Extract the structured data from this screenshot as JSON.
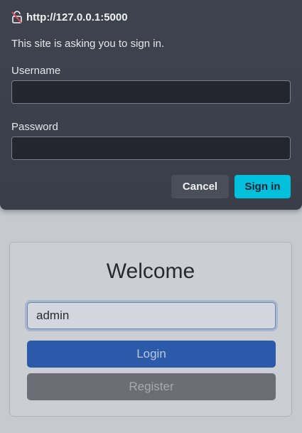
{
  "auth_dialog": {
    "site": "http://127.0.0.1:5000",
    "message": "This site is asking you to sign in.",
    "username_label": "Username",
    "username_value": "",
    "password_label": "Password",
    "password_value": "",
    "cancel_label": "Cancel",
    "signin_label": "Sign in",
    "lock_icon": "lock-warning-icon",
    "accent_color": "#00c0dc"
  },
  "page": {
    "title": "Welcome",
    "username_value": "admin",
    "login_label": "Login",
    "register_label": "Register",
    "primary_color": "#2a5aa9",
    "secondary_color": "#6b6f75"
  }
}
